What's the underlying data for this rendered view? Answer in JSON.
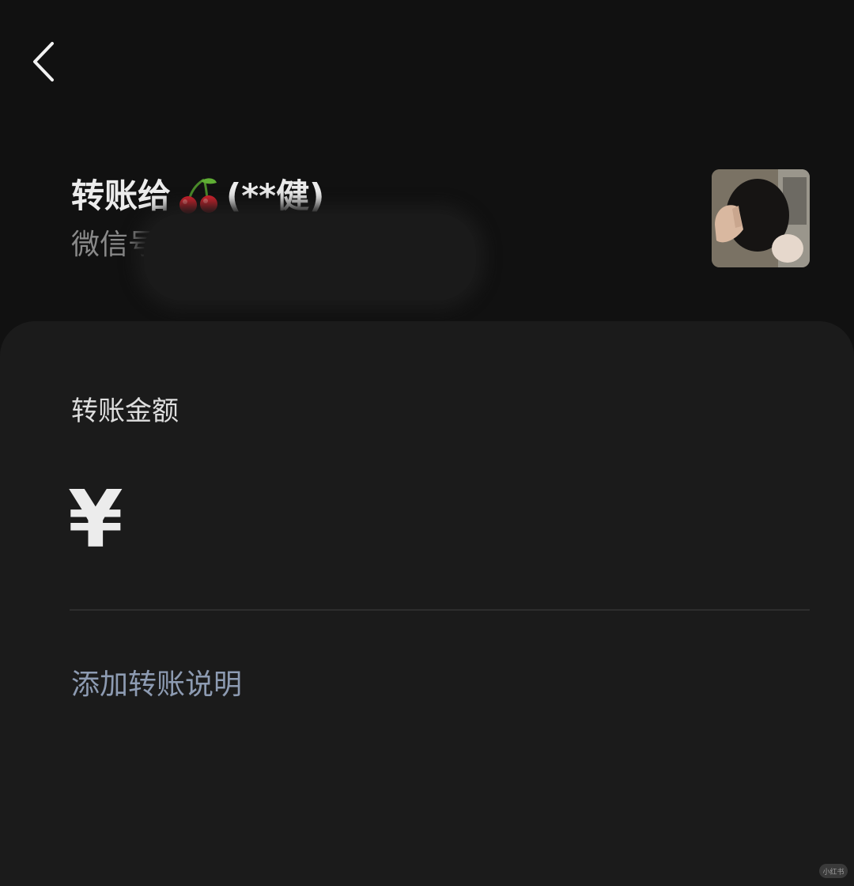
{
  "nav": {
    "back_icon": "chevron-left-icon"
  },
  "header": {
    "transfer_prefix": "转账给",
    "recipient_emoji_icon": "cherry-icon",
    "recipient_name": "(**健)",
    "wechat_id_label": "微信号"
  },
  "form": {
    "amount_label": "转账金额",
    "currency_symbol": "¥",
    "amount_value": "",
    "add_note_label": "添加转账说明"
  },
  "footer": {
    "watermark": "小红书"
  },
  "colors": {
    "background": "#111111",
    "panel": "#1b1b1b",
    "text_primary": "#ececec",
    "text_secondary": "#8a8a8a",
    "link": "#8d9bb2"
  }
}
